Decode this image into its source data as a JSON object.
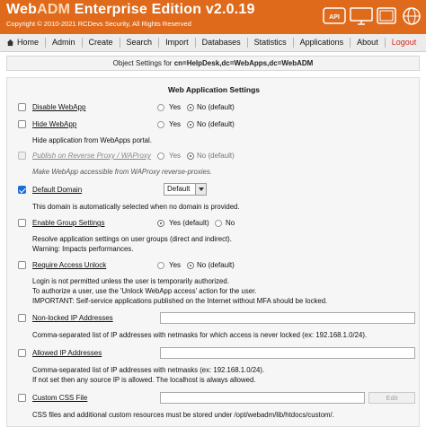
{
  "header": {
    "brand_main": "Web",
    "brand_accent": "ADM",
    "brand_rest": " Enterprise Edition v2.0.19",
    "copyright": "Copyright © 2010-2021 RCDevs Security, All Rights Reserved",
    "icons": [
      "api-icon",
      "monitor-icon",
      "tablet-icon",
      "globe-icon"
    ],
    "api_label": "API",
    "brand_color": "#df6a1b"
  },
  "nav": {
    "items": [
      "Home",
      "Admin",
      "Create",
      "Search",
      "Import",
      "Databases",
      "Statistics",
      "Applications",
      "About",
      "Logout"
    ]
  },
  "breadcrumb": {
    "prefix": "Object Settings for ",
    "dn": "cn=HelpDesk,dc=WebApps,dc=WebADM"
  },
  "section_title": "Web Application Settings",
  "settings": {
    "disable_webapp": {
      "label": "Disable WebApp",
      "yes": "Yes",
      "no": "No (default)"
    },
    "hide_webapp": {
      "label": "Hide WebApp",
      "yes": "Yes",
      "no": "No (default)",
      "desc": "Hide application from WebApps portal."
    },
    "publish_reverse_proxy": {
      "label": "Publish on Reverse Proxy / WAProxy",
      "yes": "Yes",
      "no": "No (default)",
      "desc": "Make WebApp accessible from WAProxy reverse-proxies."
    },
    "default_domain": {
      "label": "Default Domain",
      "value": "Default",
      "desc": "This domain is automatically selected when no domain is provided."
    },
    "group_settings": {
      "label": "Enable Group Settings",
      "yes": "Yes (default)",
      "no": "No",
      "desc1": "Resolve application settings on user groups (direct and indirect).",
      "desc2": "Warning: Impacts performances."
    },
    "access_unlock": {
      "label": "Require Access Unlock",
      "yes": "Yes",
      "no": "No (default)",
      "desc1": "Login is not permitted unless the user is temporarily authorized.",
      "desc2": "To authorize a user, use the 'Unlock WebApp access' action for the user.",
      "desc3": "IMPORTANT: Self-service applications published on the Internet without MFA should be locked."
    },
    "nonlocked_ips": {
      "label": "Non-locked IP Addresses",
      "value": "",
      "desc": "Comma-separated list of IP addresses with netmasks for which access is never locked (ex: 192.168.1.0/24)."
    },
    "allowed_ips": {
      "label": "Allowed IP Addresses",
      "value": "",
      "desc1": "Comma-separated list of IP addresses with netmasks (ex: 192.168.1.0/24).",
      "desc2": "If not set then any source IP is allowed. The localhost is always allowed."
    },
    "custom_css": {
      "label": "Custom CSS File",
      "value": "",
      "edit": "Edit",
      "desc": "CSS files and additional custom resources must be stored under /opt/webadm/lib/htdocs/custom/."
    }
  }
}
